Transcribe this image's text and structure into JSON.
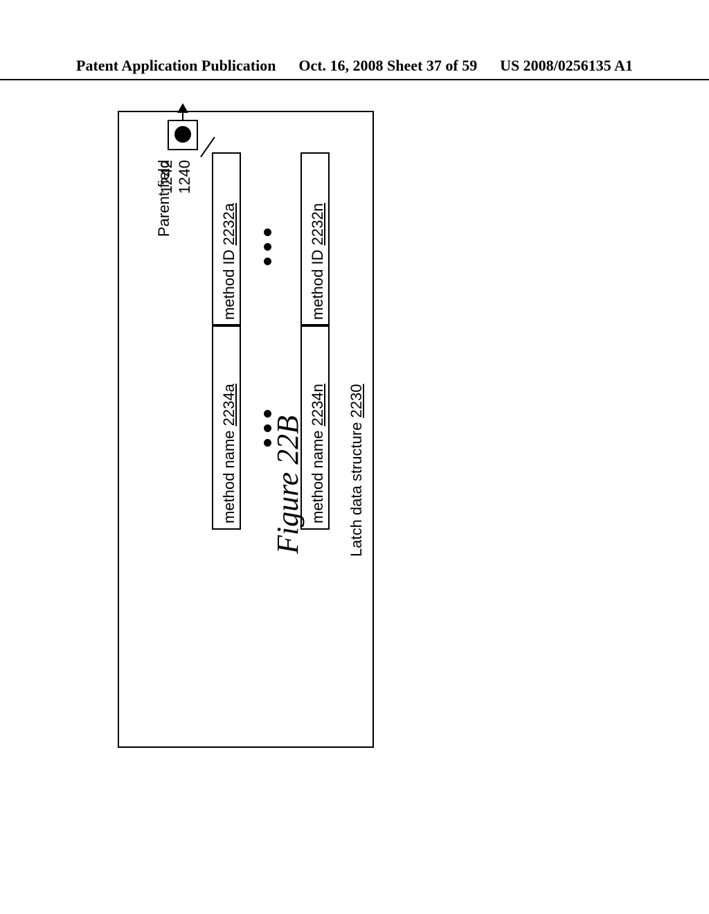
{
  "header": {
    "left": "Patent Application Publication",
    "center": "Oct. 16, 2008  Sheet 37 of 59",
    "right": "US 2008/0256135 A1"
  },
  "figure_caption": "Figure 22B",
  "diagram": {
    "ref_1242": "1242",
    "ref_1240": "1240",
    "parent_field": "Parent field",
    "method_id_a_text": "method ID ",
    "method_id_a_num": "2232a",
    "method_id_n_text": "method ID ",
    "method_id_n_num": "2232n",
    "method_name_a_text": "method name ",
    "method_name_a_num": "2234a",
    "method_name_n_text": "method name ",
    "method_name_n_num": "2234n",
    "latch_text": "Latch data structure ",
    "latch_num": "2230"
  }
}
